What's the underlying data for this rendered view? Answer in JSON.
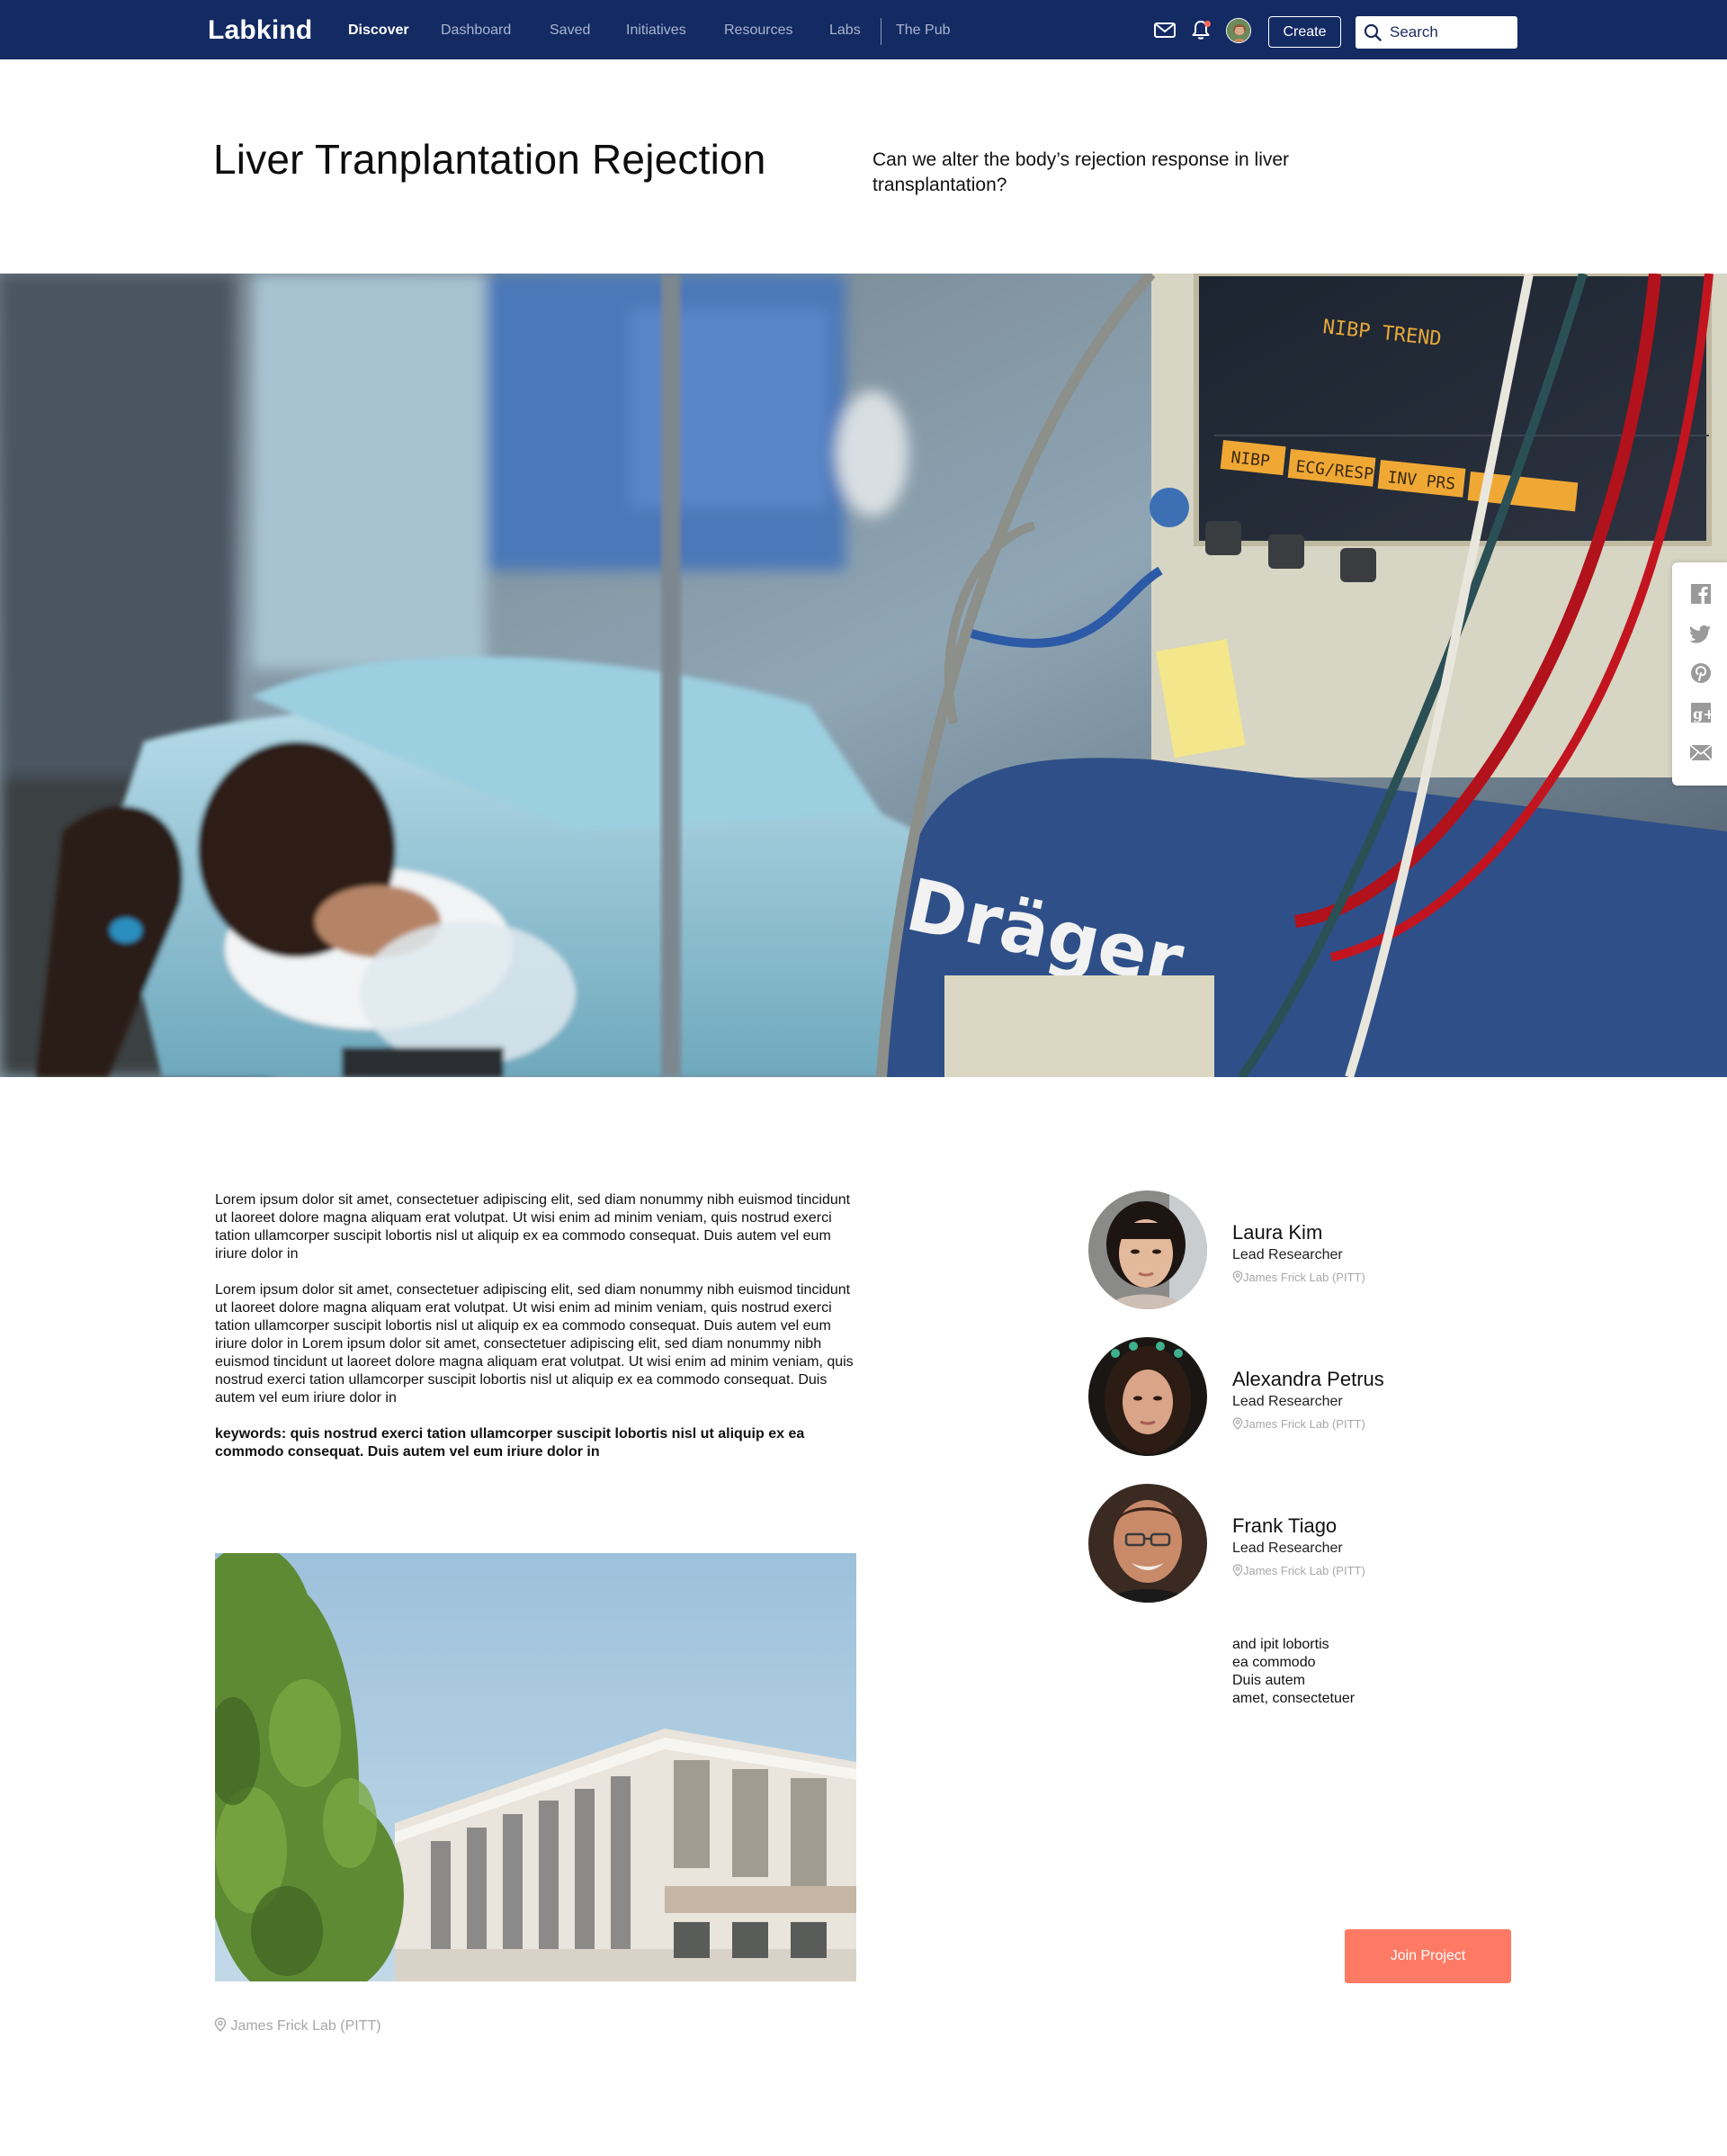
{
  "nav": {
    "brand": "Labkind",
    "links": [
      "Discover",
      "Dashboard",
      "Saved",
      "Initiatives",
      "Resources",
      "Labs",
      "The Pub"
    ],
    "active": "Discover",
    "create_label": "Create",
    "search_placeholder": "Search"
  },
  "header": {
    "title": "Liver Tranplantation Rejection",
    "question": "Can we alter the body’s rejection response in liver transplantation?"
  },
  "hero": {
    "monitor_texts": [
      "NIBP TREND",
      "NIBP",
      "ECG/RESP",
      "INV PRS",
      "Dräger"
    ]
  },
  "social": [
    "facebook-icon",
    "twitter-icon",
    "pinterest-icon",
    "google-plus-icon",
    "email-icon"
  ],
  "content": {
    "paragraph_1": "Lorem ipsum dolor sit amet, consectetuer adipiscing elit, sed diam nonummy nibh euismod tincidunt ut laoreet dolore magna aliquam erat volutpat. Ut wisi enim ad minim veniam, quis nostrud exerci tation ullamcorper suscipit lobortis nisl ut aliquip ex ea commodo consequat. Duis autem vel eum iriure dolor in",
    "paragraph_2": "Lorem ipsum dolor sit amet, consectetuer adipiscing elit, sed diam nonummy nibh euismod tincidunt ut laoreet dolore magna aliquam erat volutpat. Ut wisi enim ad minim veniam, quis nostrud exerci tation ullamcorper suscipit lobortis nisl ut aliquip ex ea commodo consequat. Duis autem vel eum iriure dolor in Lorem ipsum dolor sit amet, consectetuer adipiscing elit, sed diam nonummy nibh euismod tincidunt ut laoreet dolore magna aliquam erat volutpat. Ut wisi enim ad minim veniam, quis nostrud exerci tation ullamcorper suscipit lobortis nisl ut aliquip ex ea commodo consequat. Duis autem vel eum iriure dolor in",
    "keywords": "keywords: quis nostrud exerci tation ullamcorper suscipit lobortis nisl ut aliquip ex ea commodo consequat. Duis autem vel eum iriure dolor in",
    "lab_location": "James Frick Lab (PITT)"
  },
  "researchers": [
    {
      "name": "Laura Kim",
      "role": "Lead Researcher",
      "lab": "James Frick Lab (PITT)"
    },
    {
      "name": "Alexandra Petrus",
      "role": "Lead Researcher",
      "lab": "James Frick Lab (PITT)"
    },
    {
      "name": "Frank Tiago",
      "role": "Lead Researcher",
      "lab": "James Frick Lab (PITT)"
    }
  ],
  "side_note": [
    "and ipit lobortis",
    "ea commodo",
    "Duis autem",
    "amet, consectetuer"
  ],
  "join_label": "Join Project",
  "colors": {
    "nav": "#132a63",
    "accent": "#ff7a65"
  }
}
